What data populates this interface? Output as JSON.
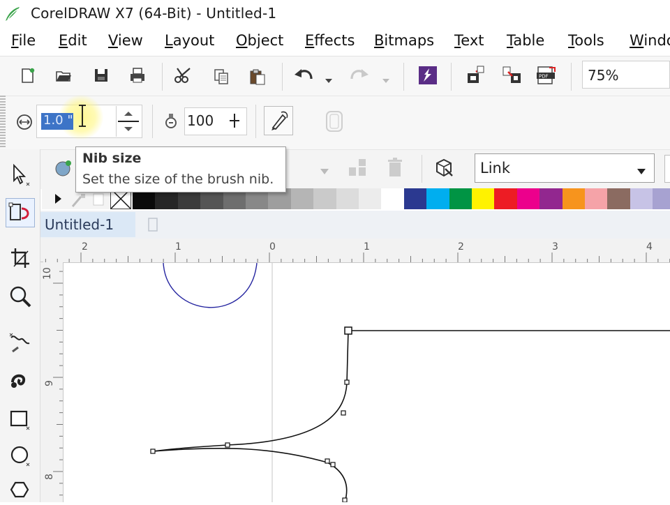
{
  "window": {
    "title": "CorelDRAW X7 (64-Bit) - Untitled-1"
  },
  "menu": [
    {
      "label": "File"
    },
    {
      "label": "Edit"
    },
    {
      "label": "View"
    },
    {
      "label": "Layout"
    },
    {
      "label": "Object"
    },
    {
      "label": "Effects"
    },
    {
      "label": "Bitmaps"
    },
    {
      "label": "Text"
    },
    {
      "label": "Table"
    },
    {
      "label": "Tools"
    },
    {
      "label": "Windo"
    }
  ],
  "standard_toolbar": {
    "icons": [
      "new-document-icon",
      "open-folder-icon",
      "save-icon",
      "print-icon",
      "cut-icon",
      "copy-icon",
      "paste-icon",
      "undo-icon",
      "redo-icon",
      "search-content-icon",
      "import-icon",
      "export-icon",
      "publish-pdf-icon"
    ],
    "zoom_level": "75%"
  },
  "property_bar": {
    "nib_size_value": "1.0 \"",
    "smoothing_value": "100"
  },
  "tooltip": {
    "title": "Nib size",
    "description": "Set the size of the brush nib."
  },
  "property_row2": {
    "link_mode": "Link"
  },
  "palette": {
    "colors": [
      "#0b0b0b",
      "#262626",
      "#3b3b3b",
      "#555555",
      "#6e6e6e",
      "#888888",
      "#9e9e9e",
      "#b5b5b5",
      "#cacaca",
      "#dcdcdc",
      "#ececec",
      "#ffffff",
      "#2b3990",
      "#00aeef",
      "#009444",
      "#fff200",
      "#ed1c24",
      "#ec008c",
      "#92278f",
      "#f7941d",
      "#f5a3a8",
      "#8b6b61",
      "#c7c3e6",
      "#a7a2d1",
      "#6f83c7"
    ]
  },
  "document": {
    "tab_label": "Untitled-1"
  },
  "rulers": {
    "horizontal_labels": [
      "2",
      "1",
      "0",
      "1",
      "2",
      "3",
      "4"
    ],
    "vertical_labels": [
      "10",
      "9",
      "8"
    ]
  }
}
